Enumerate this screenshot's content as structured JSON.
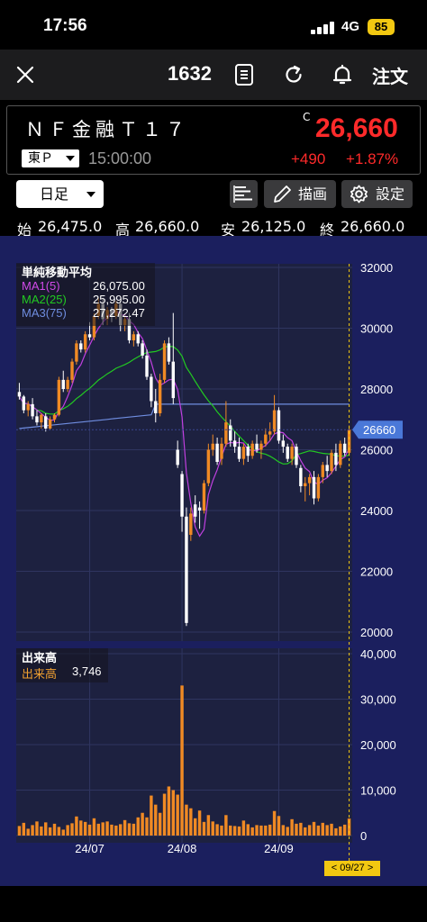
{
  "status": {
    "time": "17:56",
    "network": "4G",
    "battery": "85"
  },
  "nav": {
    "code": "1632",
    "order_label": "注文"
  },
  "stock": {
    "name": "ＮＦ金融Ｔ１７",
    "mark": "C",
    "price": "26,660",
    "market": "東Ｐ",
    "time": "15:00:00",
    "change": "+490",
    "change_pct": "+1.87%"
  },
  "toolbar": {
    "period": "日足",
    "draw_label": "描画",
    "settings_label": "設定"
  },
  "ohlc": {
    "open_label": "始",
    "open": "26,475.0",
    "high_label": "高",
    "high": "26,660.0",
    "low_label": "安",
    "low": "26,125.0",
    "close_label": "終",
    "close": "26,660.0"
  },
  "legend": {
    "title": "単純移動平均",
    "ma1_label": "MA1(5)",
    "ma1_value": "26,075.00",
    "ma2_label": "MA2(25)",
    "ma2_value": "25,995.00",
    "ma3_label": "MA3(75)",
    "ma3_value": "27,272.47"
  },
  "volume_legend": {
    "title": "出来高",
    "label": "出来高",
    "value": "3,746"
  },
  "date_badge": "< 09/27 >",
  "colors": {
    "up": "#f08a24",
    "down": "#ffffff",
    "ma1": "#c040e0",
    "ma2": "#22c922",
    "ma3": "#6f8de0",
    "price": "#ff2a2a",
    "bg": "#1b1f5e"
  },
  "chart_data": [
    {
      "type": "candlestick",
      "title": "",
      "price_ylim": [
        20000,
        32000
      ],
      "y_ticks": [
        "32000",
        "30000",
        "28000",
        "26000",
        "24000",
        "22000",
        "20000"
      ],
      "x_ticks": [
        "24/07",
        "24/08",
        "24/09"
      ],
      "last_price_label": "26660",
      "moving_averages": [
        {
          "name": "MA1(5)",
          "last": 26075.0
        },
        {
          "name": "MA2(25)",
          "last": 25995.0
        },
        {
          "name": "MA3(75)",
          "last": 27272.47
        }
      ],
      "candles": [
        [
          27900,
          28200,
          27650,
          27750
        ],
        [
          27750,
          27800,
          27200,
          27300
        ],
        [
          27300,
          27600,
          27100,
          27500
        ],
        [
          27500,
          27700,
          27000,
          27100
        ],
        [
          27100,
          27300,
          26800,
          26900
        ],
        [
          26900,
          27200,
          26700,
          27150
        ],
        [
          27100,
          27200,
          26600,
          26700
        ],
        [
          26700,
          27100,
          26650,
          27000
        ],
        [
          27000,
          27200,
          26900,
          27150
        ],
        [
          27150,
          28400,
          27100,
          28300
        ],
        [
          28300,
          28600,
          27900,
          28000
        ],
        [
          28000,
          28400,
          27900,
          28300
        ],
        [
          28300,
          29000,
          28200,
          28900
        ],
        [
          28900,
          29600,
          28800,
          29500
        ],
        [
          29500,
          29600,
          29200,
          29300
        ],
        [
          29300,
          29900,
          29200,
          29800
        ],
        [
          29800,
          30200,
          29600,
          29700
        ],
        [
          29700,
          30500,
          29600,
          30400
        ],
        [
          30400,
          31000,
          30300,
          30800
        ],
        [
          30800,
          31000,
          30100,
          30300
        ],
        [
          30300,
          30700,
          30100,
          30600
        ],
        [
          30600,
          30700,
          30200,
          30400
        ],
        [
          30400,
          30900,
          30300,
          30800
        ],
        [
          30800,
          30900,
          29900,
          30100
        ],
        [
          30100,
          30400,
          29900,
          30300
        ],
        [
          30300,
          30500,
          29500,
          29600
        ],
        [
          29600,
          29900,
          29400,
          29800
        ],
        [
          29800,
          29900,
          29400,
          29500
        ],
        [
          29500,
          29600,
          29000,
          29100
        ],
        [
          29100,
          29300,
          28300,
          28400
        ],
        [
          28400,
          28500,
          27400,
          27600
        ],
        [
          27600,
          28000,
          26900,
          27200
        ],
        [
          27200,
          28500,
          27100,
          28300
        ],
        [
          28300,
          29600,
          28200,
          29500
        ],
        [
          29500,
          29700,
          28800,
          28900
        ],
        [
          28900,
          30500,
          27500,
          27700
        ],
        [
          26000,
          26300,
          25400,
          25500
        ],
        [
          25200,
          25300,
          23300,
          23800
        ],
        [
          23800,
          24100,
          20200,
          20300
        ],
        [
          23200,
          24100,
          23000,
          23900
        ],
        [
          24200,
          24500,
          23600,
          23800
        ],
        [
          24100,
          24300,
          23400,
          24000
        ],
        [
          24000,
          25000,
          23900,
          24900
        ],
        [
          24900,
          26200,
          24800,
          26000
        ],
        [
          26000,
          26500,
          25800,
          26200
        ],
        [
          26200,
          26400,
          25500,
          25600
        ],
        [
          25700,
          26400,
          25500,
          26200
        ],
        [
          26200,
          27600,
          26100,
          26900
        ],
        [
          26800,
          27000,
          26100,
          26300
        ],
        [
          26300,
          26600,
          25900,
          26100
        ],
        [
          26100,
          26400,
          25600,
          25700
        ],
        [
          25700,
          26200,
          25500,
          26100
        ],
        [
          26100,
          26200,
          25600,
          25800
        ],
        [
          25800,
          26300,
          25700,
          26200
        ],
        [
          26200,
          26500,
          25900,
          26000
        ],
        [
          26000,
          26300,
          25700,
          26200
        ],
        [
          26200,
          26700,
          26100,
          26500
        ],
        [
          26500,
          26900,
          26300,
          26600
        ],
        [
          26600,
          27800,
          26500,
          27300
        ],
        [
          27300,
          27400,
          26200,
          26300
        ],
        [
          26300,
          26500,
          25900,
          26100
        ],
        [
          26100,
          26200,
          25600,
          25700
        ],
        [
          25700,
          26200,
          25500,
          26100
        ],
        [
          26100,
          26200,
          25400,
          25500
        ],
        [
          25400,
          25500,
          24600,
          24800
        ],
        [
          24800,
          25100,
          24300,
          24900
        ],
        [
          24900,
          25200,
          24500,
          25100
        ],
        [
          25100,
          25300,
          24200,
          24400
        ],
        [
          24400,
          25200,
          24300,
          25100
        ],
        [
          25100,
          25600,
          24900,
          25500
        ],
        [
          25500,
          25800,
          25100,
          25300
        ],
        [
          25300,
          26000,
          25200,
          25900
        ],
        [
          25900,
          26200,
          25300,
          25500
        ],
        [
          25500,
          26300,
          25400,
          26200
        ],
        [
          26200,
          26400,
          25800,
          25900
        ],
        [
          25900,
          26800,
          25800,
          26660
        ]
      ],
      "volume_ylim": [
        0,
        40000
      ],
      "volume_y_ticks": [
        "40,000",
        "30,000",
        "20,000",
        "10,000",
        "0"
      ],
      "volume": [
        2100,
        2800,
        1500,
        2300,
        3100,
        2000,
        2900,
        1800,
        2600,
        1900,
        1300,
        2300,
        2700,
        4200,
        3300,
        3000,
        2400,
        3800,
        2600,
        2900,
        3100,
        2400,
        2200,
        2500,
        3400,
        2700,
        2600,
        4000,
        5000,
        4000,
        8800,
        6800,
        5000,
        9200,
        10800,
        10000,
        9000,
        33000,
        6800,
        6000,
        3800,
        5500,
        3000,
        4500,
        3100,
        2500,
        2200,
        4500,
        2200,
        2100,
        2000,
        3300,
        2500,
        1800,
        2300,
        2200,
        2200,
        2400,
        5400,
        4300,
        2300,
        1900,
        3600,
        2600,
        2800,
        1800,
        2300,
        3000,
        2200,
        2800,
        2300,
        2600,
        1600,
        2000,
        2400,
        3746
      ]
    }
  ]
}
